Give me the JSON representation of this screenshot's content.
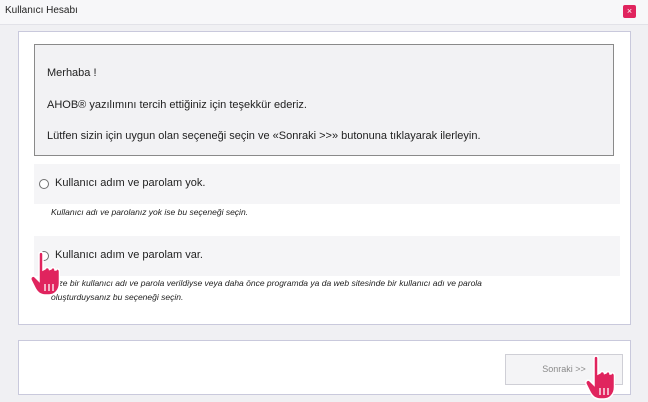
{
  "window": {
    "title": "Kullanıcı Hesabı",
    "close_symbol": "×"
  },
  "greeting": {
    "line1": "Merhaba !",
    "line2": "AHOB® yazılımını tercih ettiğiniz için teşekkür ederiz.",
    "line3": "Lütfen sizin için uygun olan seçeneği seçin ve «Sonraki >>» butonuna tıklayarak ilerleyin."
  },
  "options": [
    {
      "label": "Kullanıcı adım ve parolam yok.",
      "hint": "Kullanıcı adı ve parolanız yok ise bu seçeneği seçin.",
      "selected": false
    },
    {
      "label": "Kullanıcı adım ve parolam var.",
      "hint_line1": "Size bir kullanıcı adı ve parola verildiyse veya daha önce programda ya da web sitesinde bir kullanıcı adı ve parola",
      "hint_line2": "oluşturduysanız bu seçeneği seçin.",
      "selected": false
    }
  ],
  "footer": {
    "next_label": "Sonraki >>"
  },
  "cursor": {
    "color": "#e0245e",
    "icon": "hand-pointer-icon"
  }
}
